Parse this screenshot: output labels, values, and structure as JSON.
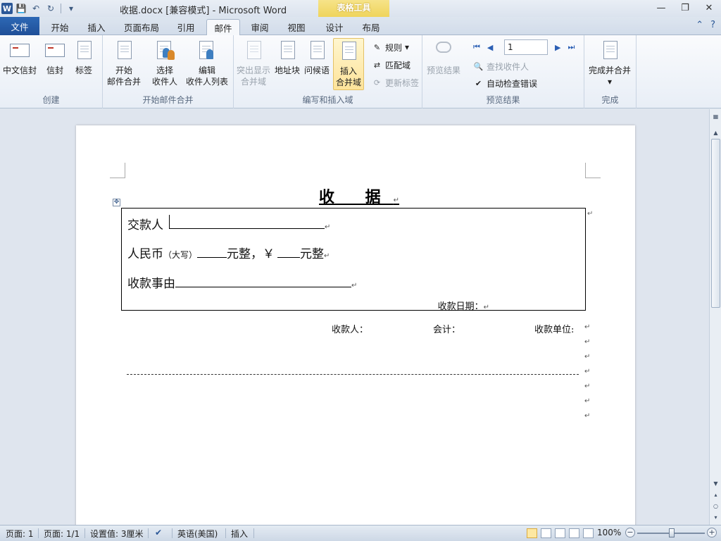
{
  "title": "收据.docx [兼容模式] - Microsoft Word",
  "context_tab": "表格工具",
  "window_controls": [
    "—",
    "❐",
    "✕"
  ],
  "tabs": [
    "文件",
    "开始",
    "插入",
    "页面布局",
    "引用",
    "邮件",
    "审阅",
    "视图",
    "设计",
    "布局"
  ],
  "ribbon": {
    "create": {
      "label": "创建",
      "buttons": [
        "中文信封",
        "信封",
        "标签"
      ]
    },
    "start_merge": {
      "label": "开始邮件合并",
      "start_line1": "开始",
      "start_line2": "邮件合并",
      "select_line1": "选择",
      "select_line2": "收件人",
      "edit_line1": "编辑",
      "edit_line2": "收件人列表"
    },
    "write_insert": {
      "label": "编写和插入域",
      "highlight_line1": "突出显示",
      "highlight_line2": "合并域",
      "address_block": "地址块",
      "greeting": "问候语",
      "insert_line1": "插入",
      "insert_line2": "合并域",
      "rules": "规则",
      "match_fields": "匹配域",
      "update_labels": "更新标签"
    },
    "preview": {
      "label": "预览结果",
      "preview_results": "预览结果",
      "record_value": "1",
      "find_recipient": "查找收件人",
      "auto_check": "自动检查错误"
    },
    "finish": {
      "label": "完成",
      "finish_merge": "完成并合并"
    }
  },
  "document": {
    "title": "收    据",
    "payer_label": "交款人",
    "rmb_label": "人民币",
    "rmb_paren": "（大写）",
    "yuan_whole1": "元整，￥",
    "yuan_whole2": "元整",
    "reason_label": "收款事由",
    "date_label": "收款日期：",
    "receiver_label": "收款人：",
    "accountant_label": "会计：",
    "unit_label": "收款单位:",
    "para_mark": "↵"
  },
  "status": {
    "page": "页面: 1",
    "pages": "页面: 1/1",
    "setting": "设置值: 3厘米",
    "language": "英语(美国)",
    "mode": "插入",
    "zoom": "100%"
  }
}
